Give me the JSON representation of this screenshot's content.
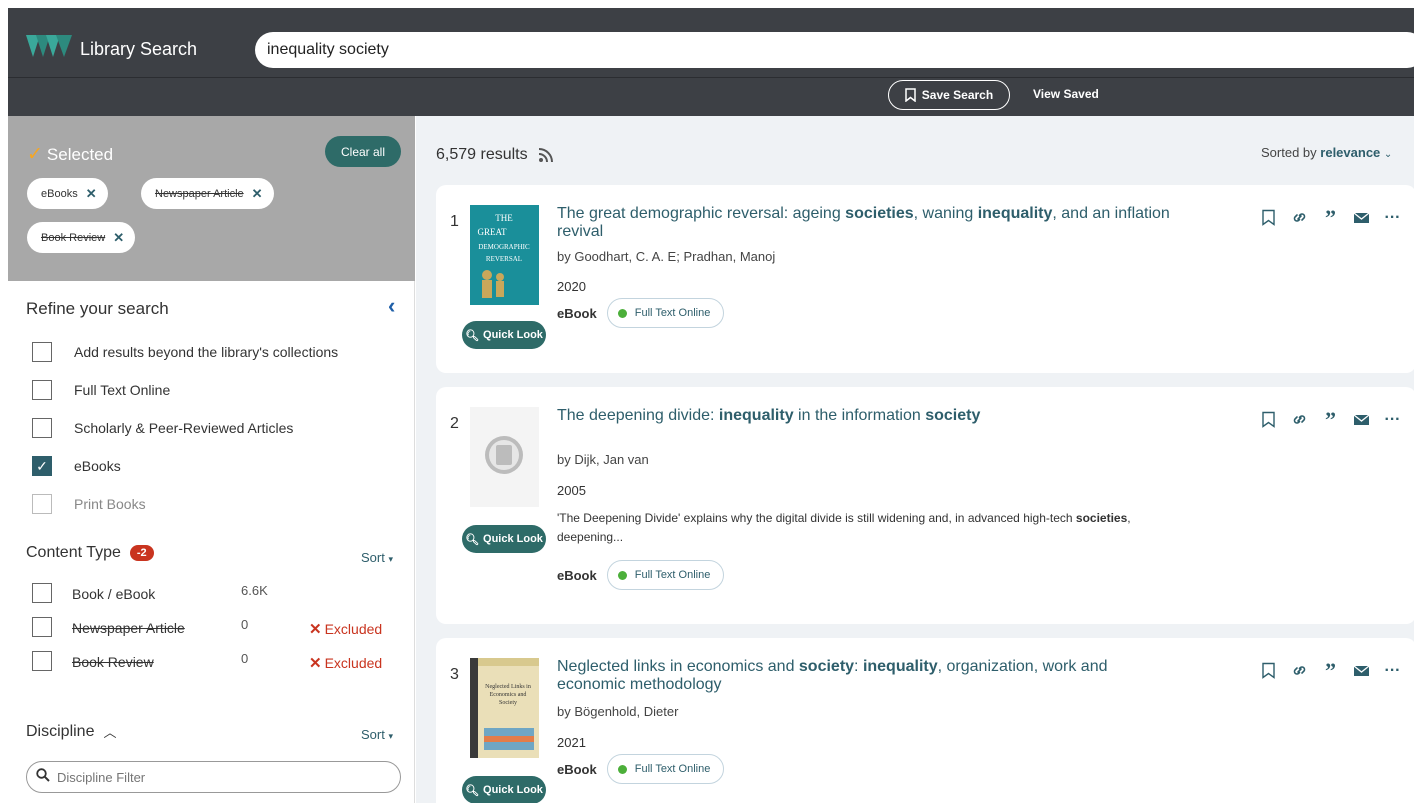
{
  "header": {
    "app_title": "Library Search",
    "search_value": "inequality society",
    "save_search_label": "Save Search",
    "view_saved_label": "View Saved"
  },
  "sidebar": {
    "selected_title": "Selected",
    "clear_all_label": "Clear all",
    "chips": [
      {
        "label": "eBooks",
        "struck": false
      },
      {
        "label": "Newspaper Article",
        "struck": true
      },
      {
        "label": "Book Review",
        "struck": true
      }
    ],
    "refine_title": "Refine your search",
    "filters": [
      {
        "label": "Add results beyond the library's collections",
        "checked": false
      },
      {
        "label": "Full Text Online",
        "checked": false
      },
      {
        "label": "Scholarly & Peer-Reviewed Articles",
        "checked": false
      },
      {
        "label": "eBooks",
        "checked": true
      },
      {
        "label": "Print Books",
        "checked": false,
        "disabled": true
      }
    ],
    "content_type": {
      "title": "Content Type",
      "badge": "-2",
      "sort_label": "Sort",
      "rows": [
        {
          "label": "Book / eBook",
          "count": "6.6K",
          "excluded": ""
        },
        {
          "label": "Newspaper Article",
          "count": "0",
          "excluded": "Excluded"
        },
        {
          "label": "Book Review",
          "count": "0",
          "excluded": "Excluded"
        }
      ]
    },
    "discipline": {
      "title": "Discipline",
      "sort_label": "Sort",
      "filter_placeholder": "Discipline Filter"
    }
  },
  "main": {
    "results_count": "6,579 results",
    "sorted_by_prefix": "Sorted by",
    "sorted_by_value": "relevance",
    "quick_look_label": "Quick Look",
    "records": [
      {
        "num": "1",
        "title_parts": [
          "The great demographic reversal: ageing ",
          "societies",
          ", waning ",
          "inequality",
          ", and an inflation revival"
        ],
        "author": "by Goodhart, C. A. E; Pradhan, Manoj",
        "year": "2020",
        "format": "eBook",
        "availability": "Full Text Online",
        "cover_text": [
          "THE",
          "GREAT",
          "DEMOGRAPHIC",
          "REVERSAL"
        ]
      },
      {
        "num": "2",
        "title_parts": [
          "The deepening divide: ",
          "inequality",
          " in the information ",
          "society"
        ],
        "author": "by Dijk, Jan van",
        "year": "2005",
        "snippet_parts": [
          "'The Deepening Divide' explains why the digital divide is still widening and, in advanced high-tech ",
          "societies",
          ", deepening..."
        ],
        "format": "eBook",
        "availability": "Full Text Online"
      },
      {
        "num": "3",
        "title_parts": [
          "Neglected links in economics and ",
          "society",
          ": ",
          "inequality",
          ", organization, work and economic methodology"
        ],
        "author": "by Bögenhold, Dieter",
        "year": "2021",
        "format": "eBook",
        "availability": "Full Text Online",
        "cover_text": [
          "Neglected Links in",
          "Economics and",
          "Society"
        ]
      }
    ]
  }
}
